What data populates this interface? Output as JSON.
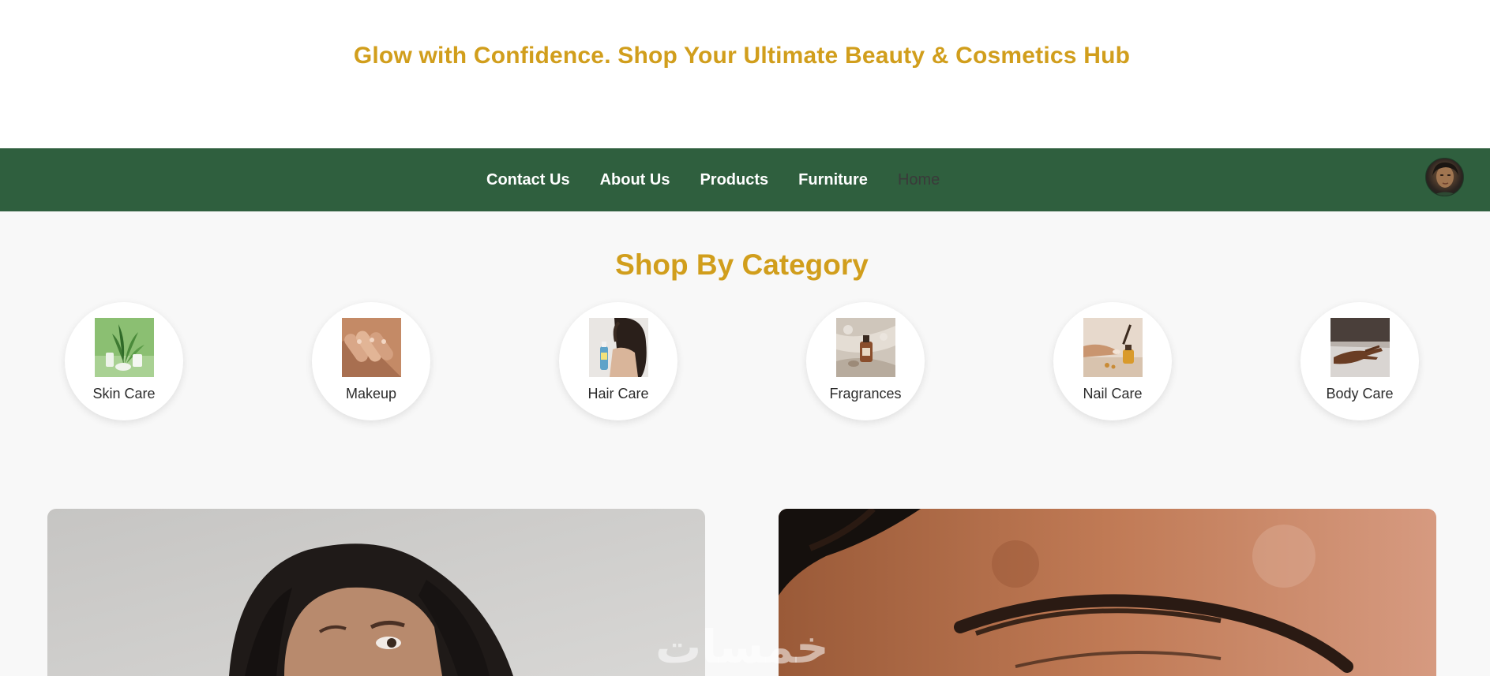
{
  "header": {
    "tagline": "Glow with Confidence. Shop Your Ultimate Beauty & Cosmetics Hub"
  },
  "nav": {
    "links": [
      {
        "label": "Contact Us",
        "active": false
      },
      {
        "label": "About Us",
        "active": false
      },
      {
        "label": "Products",
        "active": false
      },
      {
        "label": "Furniture",
        "active": false
      },
      {
        "label": "Home",
        "active": true
      }
    ],
    "avatar_icon": "user-avatar-icon"
  },
  "categories": {
    "title": "Shop By Category",
    "items": [
      {
        "label": "Skin Care",
        "thumbnail": "skin-care-thumbnail"
      },
      {
        "label": "Makeup",
        "thumbnail": "makeup-thumbnail"
      },
      {
        "label": "Hair Care",
        "thumbnail": "hair-care-thumbnail"
      },
      {
        "label": "Fragrances",
        "thumbnail": "fragrances-thumbnail"
      },
      {
        "label": "Nail Care",
        "thumbnail": "nail-care-thumbnail"
      },
      {
        "label": "Body Care",
        "thumbnail": "body-care-thumbnail"
      }
    ]
  },
  "hero": {
    "images": [
      "woman-portrait-image",
      "eyebrow-closeup-image"
    ]
  },
  "watermark": {
    "text": "خمسات"
  },
  "colors": {
    "accent_gold": "#d19e1c",
    "nav_green": "#2f5f3e",
    "nav_text": "#ffffff",
    "nav_muted": "#3a3a3a",
    "page_bg": "#f8f8f8"
  }
}
